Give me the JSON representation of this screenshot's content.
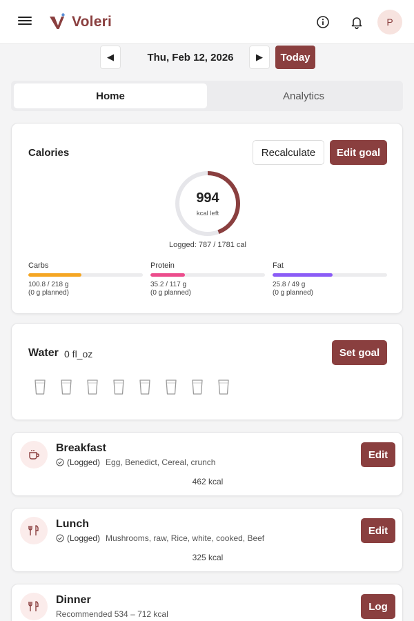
{
  "app": {
    "name": "Voleri",
    "avatar_initial": "P",
    "brand_color": "#8a3f3f"
  },
  "icons": {
    "menu": "menu-icon",
    "info": "info-icon",
    "bell": "bell-icon"
  },
  "date_nav": {
    "prev": "◀",
    "label": "Thu, Feb 12, 2026",
    "next": "▶",
    "today_label": "Today"
  },
  "tabs": [
    {
      "label": "Home",
      "active": true
    },
    {
      "label": "Analytics",
      "active": false
    }
  ],
  "calories": {
    "title": "Calories",
    "recalculate_label": "Recalculate",
    "edit_goal_label": "Edit goal",
    "remaining": "994",
    "remaining_label": "kcal left",
    "logged_text": "Logged: 787 / 1781 cal",
    "progress_fraction": 0.442,
    "macros": [
      {
        "name": "Carbs",
        "value_text": "100.8 / 218 g",
        "planned_text": "(0 g planned)",
        "fraction": 0.462,
        "color": "#f5a623"
      },
      {
        "name": "Protein",
        "value_text": "35.2 / 117 g",
        "planned_text": "(0 g planned)",
        "fraction": 0.301,
        "color": "#ec4c8c"
      },
      {
        "name": "Fat",
        "value_text": "25.8 / 49 g",
        "planned_text": "(0 g planned)",
        "fraction": 0.527,
        "color": "#8b5cf6"
      }
    ]
  },
  "water": {
    "title": "Water",
    "value": "0 fl_oz",
    "set_goal_label": "Set goal",
    "cups_total": 8,
    "cups_filled": 0
  },
  "meals": [
    {
      "name": "Breakfast",
      "icon": "coffee-cup-icon",
      "status": "(Logged)",
      "items": "Egg, Benedict, Cereal, crunch",
      "kcal": "462 kcal",
      "button": "Edit"
    },
    {
      "name": "Lunch",
      "icon": "fork-knife-icon",
      "status": "(Logged)",
      "items": "Mushrooms, raw, Rice, white, cooked, Beef",
      "kcal": "325 kcal",
      "button": "Edit"
    },
    {
      "name": "Dinner",
      "icon": "fork-knife-icon",
      "recommended": "Recommended 534 – 712 kcal",
      "button": "Log"
    }
  ]
}
